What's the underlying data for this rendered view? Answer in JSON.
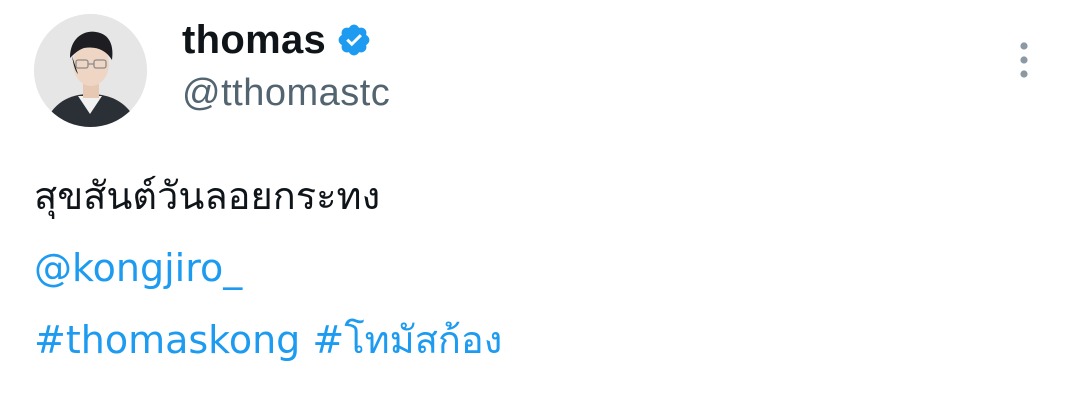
{
  "tweet": {
    "author": {
      "display_name": "thomas",
      "handle": "@tthomastc",
      "verified": true,
      "verified_icon": "verified-badge-icon",
      "avatar": "profile-photo"
    },
    "more_icon": "more-vertical-icon",
    "text_line": "สุขสันต์วันลอยกระทง",
    "mention": "@kongjiro_",
    "hashtags": [
      "#thomaskong",
      "#โทมัสก้อง"
    ]
  },
  "colors": {
    "link": "#1d9bf0",
    "text": "#0f1419",
    "secondary": "#536471",
    "verified": "#1d9bf0"
  }
}
